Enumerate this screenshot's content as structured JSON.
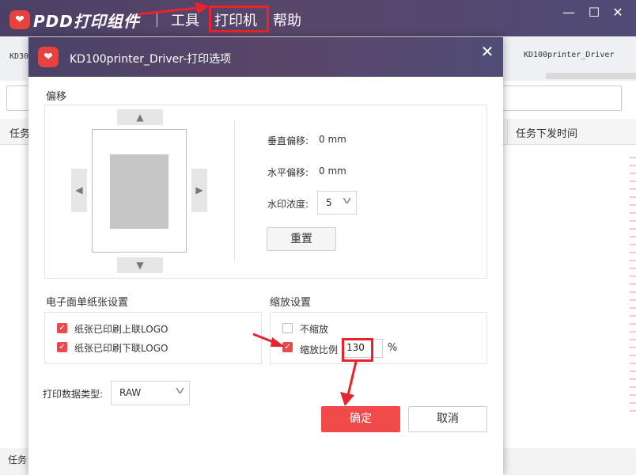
{
  "app": {
    "brand": "PDD打印组件",
    "menu": [
      "工具",
      "打印机",
      "帮助"
    ],
    "highlighted_menu": "打印机",
    "window_controls": {
      "minimize": "—",
      "maximize": "☐",
      "close": "✕"
    }
  },
  "background": {
    "printer_left": "KD30",
    "printer_right": "KD100printer_Driver",
    "col_left": "任务",
    "col_right": "任务下发时间",
    "footer_text": "任务"
  },
  "dialog": {
    "title": "KD100printer_Driver-打印选项",
    "close": "✕",
    "offset": {
      "section_label": "偏移",
      "vertical_label": "垂直偏移:",
      "vertical_value": "0 mm",
      "horizontal_label": "水平偏移:",
      "horizontal_value": "0 mm",
      "watermark_label": "水印浓度:",
      "watermark_value": "5",
      "reset_button": "重置",
      "arrows": {
        "up": "▲",
        "down": "▼",
        "left": "◀",
        "right": "▶"
      }
    },
    "paper": {
      "section_label": "电子面单纸张设置",
      "options": [
        {
          "label": "纸张已印刷上联LOGO",
          "checked": true
        },
        {
          "label": "纸张已印刷下联LOGO",
          "checked": true
        }
      ]
    },
    "scale": {
      "section_label": "缩放设置",
      "no_scale_label": "不缩放",
      "no_scale_checked": false,
      "ratio_label": "缩放比例",
      "ratio_checked": true,
      "ratio_value": "130",
      "unit": "%"
    },
    "data_type": {
      "label": "打印数据类型:",
      "value": "RAW"
    },
    "ok_button": "确定",
    "cancel_button": "取消"
  },
  "colors": {
    "title_bar": "#4f4570",
    "accent_red": "#f14a4a",
    "highlight": "#e8232b",
    "check_red": "#ea4a4a"
  },
  "icons": [
    "app-logo-icon",
    "dialog-logo-icon",
    "chevron-down-icon",
    "arrow-up-icon",
    "arrow-down-icon",
    "arrow-left-icon",
    "arrow-right-icon",
    "close-icon",
    "checkmark-icon",
    "annotation-arrow-icon"
  ]
}
